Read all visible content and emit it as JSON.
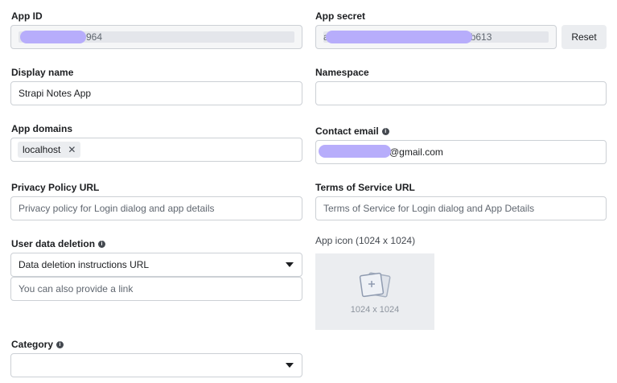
{
  "app_id": {
    "label": "App ID",
    "value_suffix": "964"
  },
  "app_secret": {
    "label": "App secret",
    "value_prefix": "a",
    "value_suffix": "b613",
    "reset_label": "Reset"
  },
  "display_name": {
    "label": "Display name",
    "value": "Strapi Notes App"
  },
  "namespace": {
    "label": "Namespace",
    "value": ""
  },
  "app_domains": {
    "label": "App domains",
    "chips": [
      "localhost"
    ]
  },
  "contact_email": {
    "label": "Contact email",
    "value_suffix": "@gmail.com"
  },
  "privacy_policy": {
    "label": "Privacy Policy URL",
    "placeholder": "Privacy policy for Login dialog and app details"
  },
  "terms_of_service": {
    "label": "Terms of Service URL",
    "placeholder": "Terms of Service for Login dialog and App Details"
  },
  "user_data_deletion": {
    "label": "User data deletion",
    "selected": "Data deletion instructions URL",
    "link_placeholder": "You can also provide a link"
  },
  "app_icon": {
    "label": "App icon (1024 x 1024)",
    "size_text": "1024 x 1024"
  },
  "category": {
    "label": "Category",
    "selected": ""
  },
  "colors": {
    "redaction": "#b7adfb",
    "border": "#ccd0d5",
    "chip_bg": "#ebedf0"
  }
}
